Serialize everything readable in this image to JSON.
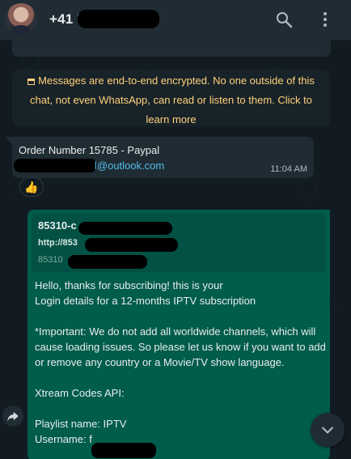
{
  "header": {
    "contact_name": "+41 7",
    "search_icon": "search-icon",
    "menu_icon": "more-vertical-icon"
  },
  "system_message": {
    "lock_icon": "lock-icon",
    "text": "Messages are end-to-end encrypted. No one outside of this chat, not even WhatsApp, can read or listen to them. Click to learn more"
  },
  "incoming_message": {
    "order_text": "Order Number 15785 - Paypal",
    "email_domain": "l@outlook.com",
    "time": "11:04 AM",
    "reaction": "👍"
  },
  "outgoing_message": {
    "quote_title": "85310-c",
    "quote_url": "http://853",
    "quote_number": "85310",
    "body": "Hello, thanks for subscribing! this is your\nLogin details for a 12-months IPTV subscription\n\n*Important: We do not add all worldwide channels, which will cause loading issues. So please let us know if you want to add or remove any country or a Movie/TV show language.\n\nXtream Codes API:\n\nPlaylist name: IPTV\nUsername: f"
  },
  "controls": {
    "forward_icon": "forward-icon",
    "scroll_icon": "chevron-down-icon"
  },
  "colors": {
    "background": "#111b21",
    "header": "#202c33",
    "incoming_bubble": "#202c33",
    "outgoing_bubble": "#005c4b",
    "system_text": "#ffd279",
    "link": "#53bdeb"
  }
}
